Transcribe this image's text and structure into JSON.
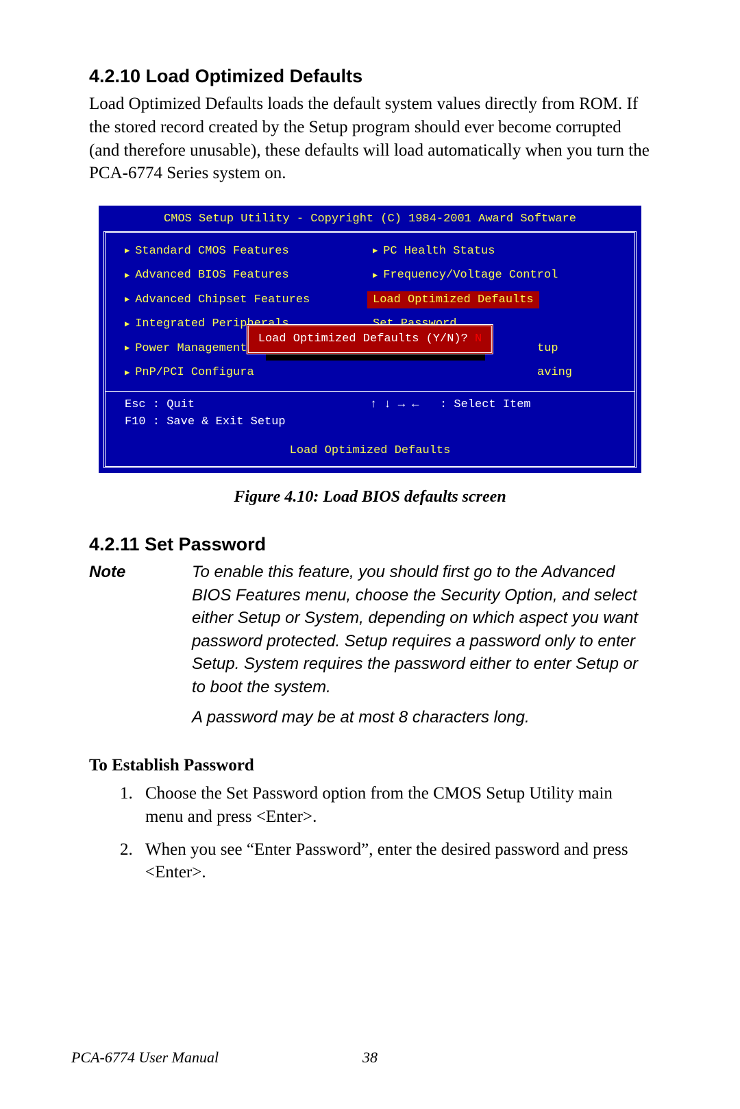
{
  "section1": {
    "heading": "4.2.10 Load Optimized Defaults",
    "body": "Load Optimized Defaults loads the default system values directly from ROM. If the stored record created by the Setup program should ever become corrupted (and therefore unusable), these defaults will load automatically when you turn the PCA-6774 Series system on."
  },
  "bios": {
    "title": "CMOS Setup Utility - Copyright (C) 1984-2001 Award Software",
    "left": [
      "Standard CMOS Features",
      "Advanced BIOS Features",
      "Advanced Chipset Features",
      "Integrated Peripherals",
      "Power Management",
      "PnP/PCI Configura"
    ],
    "right_top": [
      "PC Health Status",
      "Frequency/Voltage Control"
    ],
    "right_selected": "Load Optimized Defaults",
    "right_plain": [
      "Set Password",
      "tup",
      "aving"
    ],
    "dialog_label": "Load Optimized Defaults (Y/N)? ",
    "dialog_answer": "N",
    "keys_left": "Esc : Quit\nF10 : Save & Exit Setup",
    "keys_right": "↑ ↓ → ←   : Select Item",
    "foot_desc": "Load Optimized Defaults"
  },
  "figcap": "Figure 4.10: Load BIOS defaults screen",
  "section2": {
    "heading": "4.2.11 Set Password"
  },
  "note": {
    "label": "Note",
    "p1": "To enable this feature, you should first go to the Advanced BIOS Features menu, choose the Security Option, and select either Setup or System, depending on which aspect you want password protected. Setup requires a password only to enter Setup.  System requires the password either to enter Setup or to boot the system.",
    "p2": "A password may be at most 8 characters long."
  },
  "establish": {
    "heading": "To Establish Password",
    "step1": "Choose the Set Password option from the CMOS Setup Utility main menu and press <Enter>.",
    "step2": "When you see “Enter Password”, enter the desired password and press <Enter>."
  },
  "footer": {
    "doc": "PCA-6774 User Manual",
    "page": "38"
  }
}
